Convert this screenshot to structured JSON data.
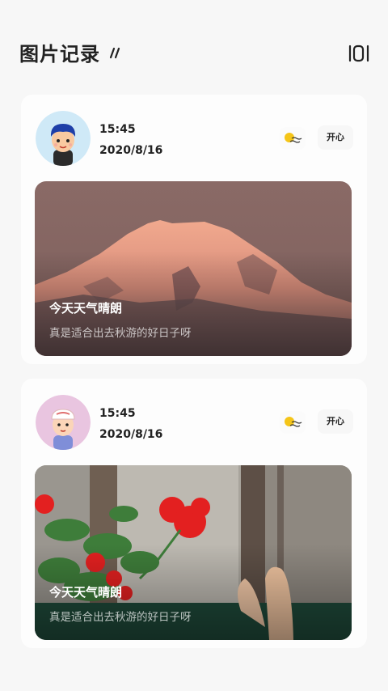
{
  "header": {
    "title": "图片记录"
  },
  "entries": [
    {
      "time": "15:45",
      "date": "2020/8/16",
      "weather_icon": "sunny-windy-icon",
      "mood": "开心",
      "caption_title": "今天天气晴朗",
      "caption_text": "真是适合出去秋游的好日子呀",
      "photo": "mountain"
    },
    {
      "time": "15:45",
      "date": "2020/8/16",
      "weather_icon": "sunny-windy-icon",
      "mood": "开心",
      "caption_title": "今天天气晴朗",
      "caption_text": "真是适合出去秋游的好日子呀",
      "photo": "flowers"
    }
  ],
  "colors": {
    "background": "#f7f7f7",
    "card": "#fdfdfd",
    "sun": "#f5c518"
  }
}
